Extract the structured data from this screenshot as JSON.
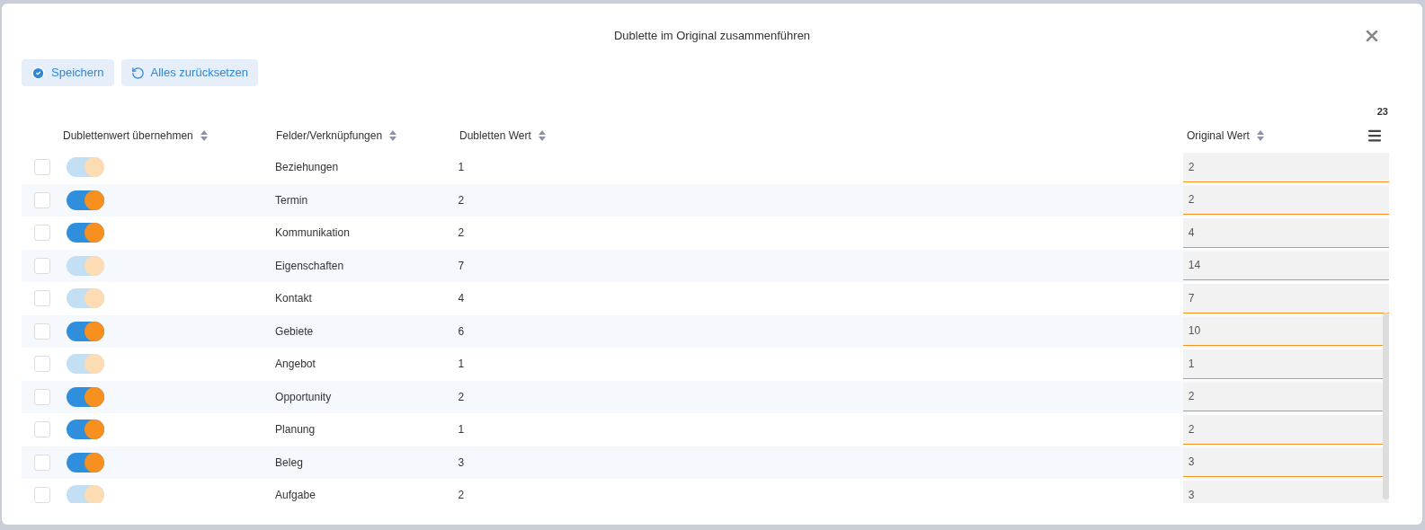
{
  "dialog": {
    "title": "Dublette im Original zusammenführen"
  },
  "toolbar": [
    {
      "kind": "save",
      "label": "Speichern"
    },
    {
      "kind": "reset",
      "label": "Alles zurücksetzen"
    }
  ],
  "count": "23",
  "columns": [
    "Dublettenwert übernehmen",
    "Felder/Verknüpfungen",
    "Dubletten Wert",
    "Original Wert"
  ],
  "rows": [
    {
      "checked": false,
      "disabled": true,
      "field": "Beziehungen",
      "duplicate": "1",
      "original": "2"
    },
    {
      "checked": false,
      "disabled": false,
      "field": "Termin",
      "duplicate": "2",
      "original": "2"
    },
    {
      "checked": false,
      "disabled": false,
      "field": "Kommunikation",
      "duplicate": "2",
      "original": "4"
    },
    {
      "checked": false,
      "disabled": true,
      "field": "Eigenschaften",
      "duplicate": "7",
      "original": "14"
    },
    {
      "checked": false,
      "disabled": true,
      "field": "Kontakt",
      "duplicate": "4",
      "original": "7"
    },
    {
      "checked": false,
      "disabled": false,
      "field": "Gebiete",
      "duplicate": "6",
      "original": "10"
    },
    {
      "checked": false,
      "disabled": true,
      "field": "Angebot",
      "duplicate": "1",
      "original": "1"
    },
    {
      "checked": false,
      "disabled": false,
      "field": "Opportunity",
      "duplicate": "2",
      "original": "2"
    },
    {
      "checked": false,
      "disabled": false,
      "field": "Planung",
      "duplicate": "1",
      "original": "2"
    },
    {
      "checked": false,
      "disabled": false,
      "field": "Beleg",
      "duplicate": "3",
      "original": "3"
    },
    {
      "checked": false,
      "disabled": true,
      "field": "Aufgabe",
      "duplicate": "2",
      "original": "3"
    }
  ]
}
